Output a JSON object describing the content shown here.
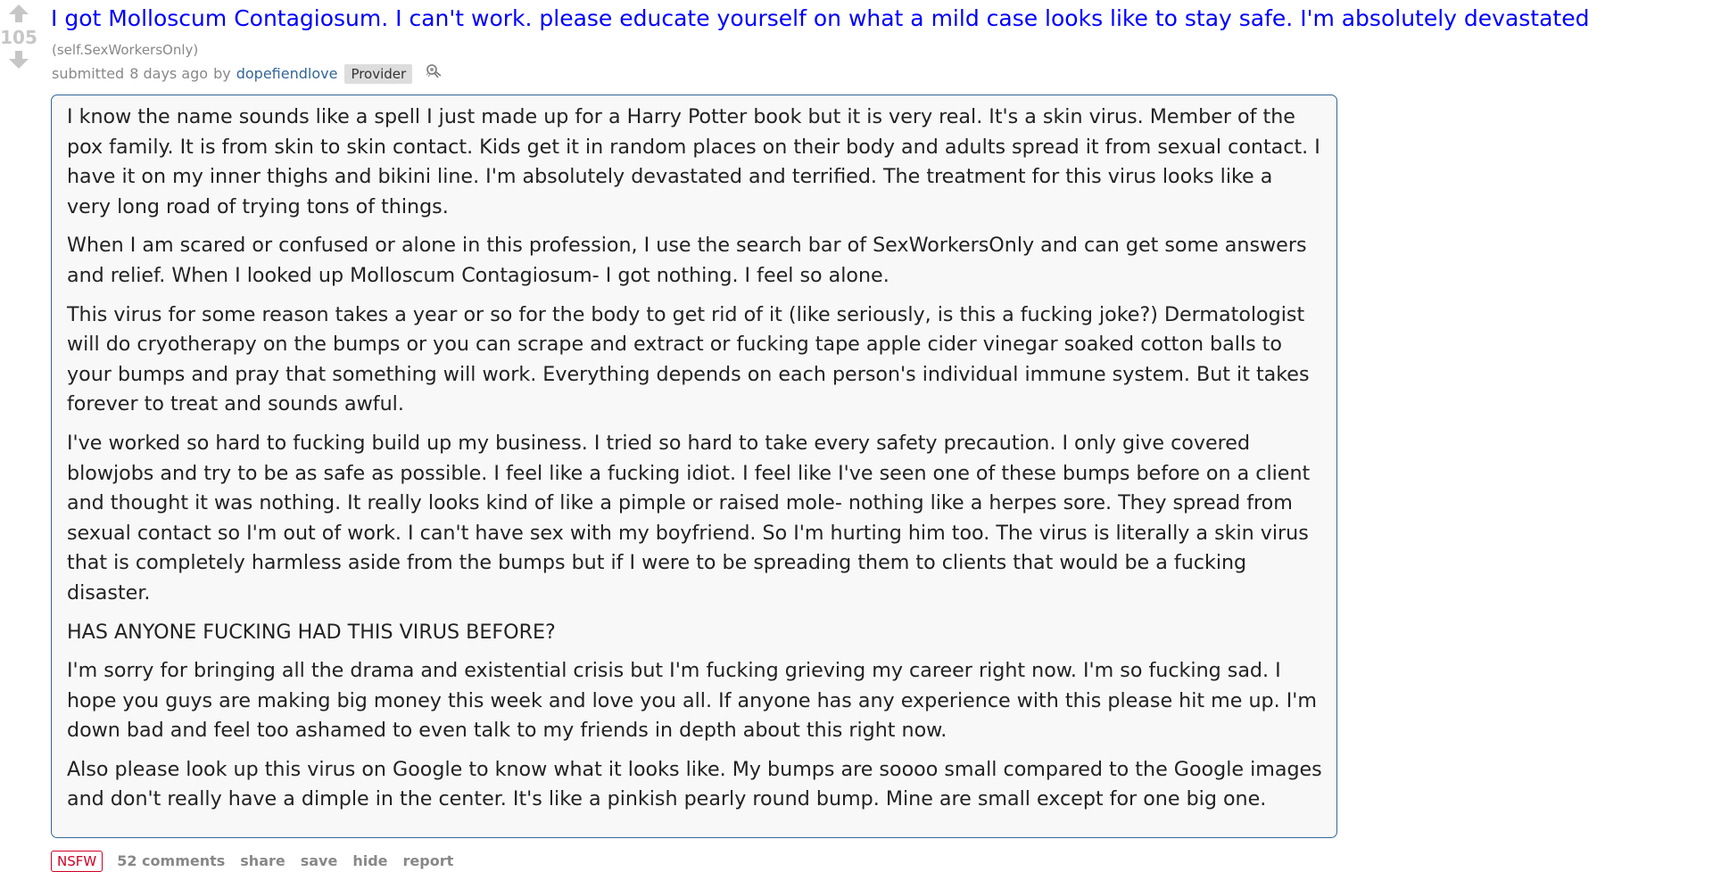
{
  "post": {
    "score": "105",
    "title": "I got Molloscum Contagiosum. I can't work. please educate yourself on what a mild case looks like to stay safe. I'm absolutely devastated",
    "domain": "(self.SexWorkersOnly)",
    "submitted_prefix": "submitted",
    "time_ago": "8 days ago",
    "by": "by",
    "author": "dopefiendlove",
    "flair": "Provider",
    "award_icon": "award-icon",
    "body": [
      "I know the name sounds like a spell I just made up for a Harry Potter book but it is very real. It's a skin virus. Member of the pox family. It is from skin to skin contact. Kids get it in random places on their body and adults spread it from sexual contact. I have it on my inner thighs and bikini line. I'm absolutely devastated and terrified. The treatment for this virus looks like a very long road of trying tons of things.",
      "When I am scared or confused or alone in this profession, I use the search bar of SexWorkersOnly and can get some answers and relief. When I looked up Molloscum Contagiosum- I got nothing. I feel so alone.",
      "This virus for some reason takes a year or so for the body to get rid of it (like seriously, is this a fucking joke?) Dermatologist will do cryotherapy on the bumps or you can scrape and extract or fucking tape apple cider vinegar soaked cotton balls to your bumps and pray that something will work. Everything depends on each person's individual immune system. But it takes forever to treat and sounds awful.",
      "I've worked so hard to fucking build up my business. I tried so hard to take every safety precaution. I only give covered blowjobs and try to be as safe as possible. I feel like a fucking idiot. I feel like I've seen one of these bumps before on a client and thought it was nothing. It really looks kind of like a pimple or raised mole- nothing like a herpes sore. They spread from sexual contact so I'm out of work. I can't have sex with my boyfriend. So I'm hurting him too. The virus is literally a skin virus that is completely harmless aside from the bumps but if I were to be spreading them to clients that would be a fucking disaster.",
      "HAS ANYONE FUCKING HAD THIS VIRUS BEFORE?",
      "I'm sorry for bringing all the drama and existential crisis but I'm fucking grieving my career right now. I'm so fucking sad. I hope you guys are making big money this week and love you all. If anyone has any experience with this please hit me up. I'm down bad and feel too ashamed to even talk to my friends in depth about this right now.",
      "Also please look up this virus on Google to know what it looks like. My bumps are soooo small compared to the Google images and don't really have a dimple in the center. It's like a pinkish pearly round bump. Mine are small except for one big one."
    ]
  },
  "buttons": {
    "nsfw": "NSFW",
    "comments": "52 comments",
    "share": "share",
    "save": "save",
    "hide": "hide",
    "report": "report"
  },
  "colors": {
    "title_link": "#0000ff",
    "author_link": "#336699",
    "meta_text": "#888888",
    "body_border": "#336699",
    "body_bg": "#f8f8f8",
    "nsfw_red": "#d10023"
  }
}
